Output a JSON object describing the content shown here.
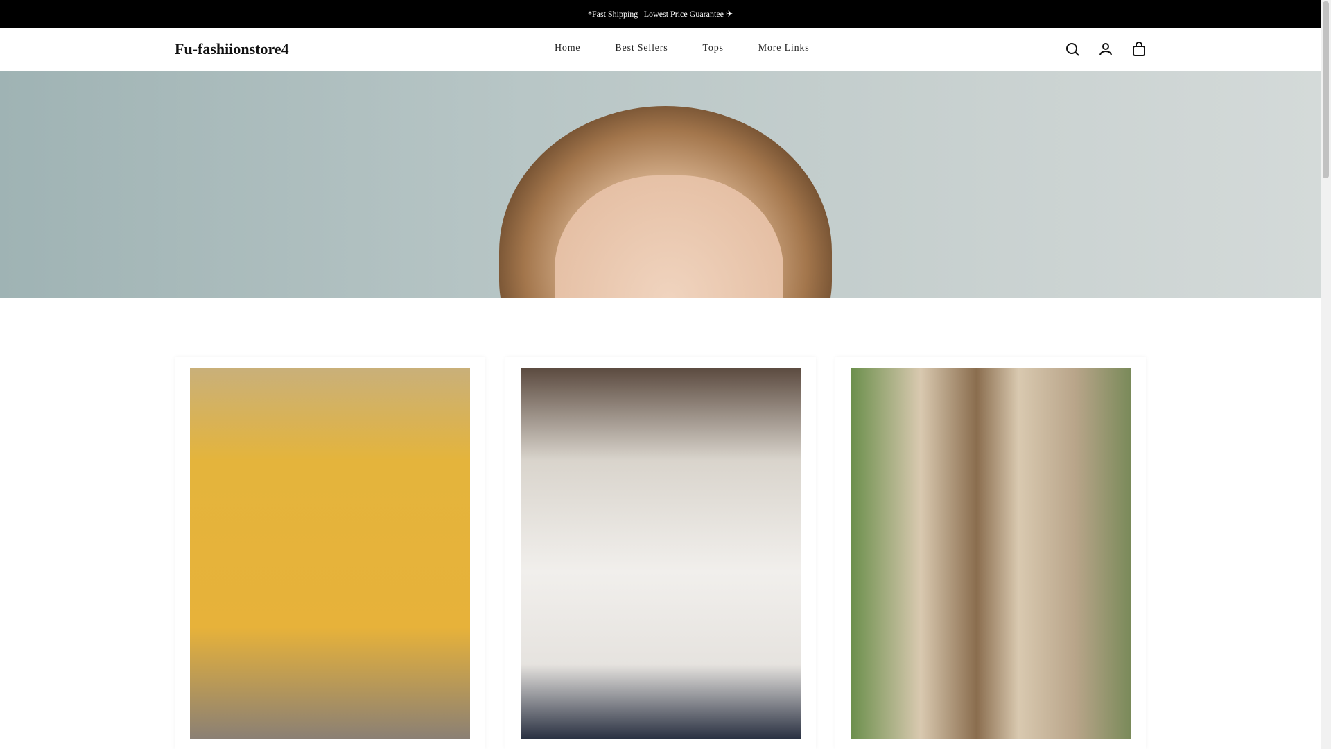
{
  "announcement": "*Fast Shipping | Lowest Price Guarantee ✈",
  "header": {
    "logo": "Fu-fashiionstore4",
    "nav": [
      "Home",
      "Best Sellers",
      "Tops",
      "More Links"
    ]
  },
  "icons": [
    "search-icon",
    "account-icon",
    "cart-icon"
  ]
}
